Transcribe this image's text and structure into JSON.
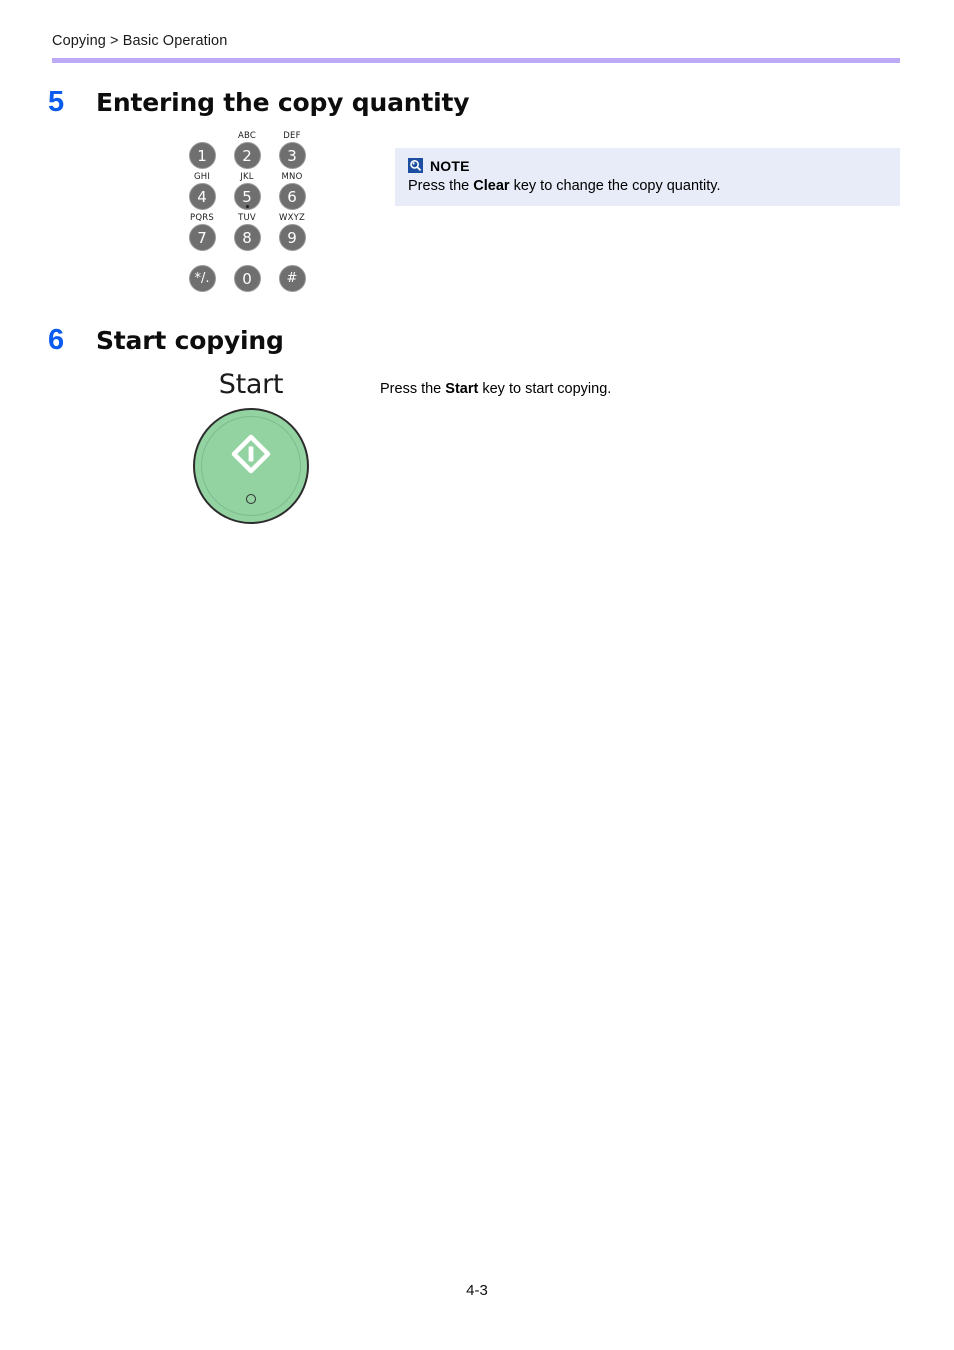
{
  "header": {
    "breadcrumb": "Copying > Basic Operation",
    "rule_color": "#bdaaf7"
  },
  "steps": [
    {
      "number": "5",
      "title": "Entering the copy quantity"
    },
    {
      "number": "6",
      "title": "Start copying"
    }
  ],
  "keypad": {
    "name": "numeric-keypad",
    "key_color": "#6f6f6f",
    "rows": [
      [
        {
          "letters": "",
          "digit": "1",
          "has_bump": false
        },
        {
          "letters": "ABC",
          "digit": "2",
          "has_bump": false
        },
        {
          "letters": "DEF",
          "digit": "3",
          "has_bump": false
        }
      ],
      [
        {
          "letters": "GHI",
          "digit": "4",
          "has_bump": false
        },
        {
          "letters": "JKL",
          "digit": "5",
          "has_bump": true
        },
        {
          "letters": "MNO",
          "digit": "6",
          "has_bump": false
        }
      ],
      [
        {
          "letters": "PQRS",
          "digit": "7",
          "has_bump": false
        },
        {
          "letters": "TUV",
          "digit": "8",
          "has_bump": false
        },
        {
          "letters": "WXYZ",
          "digit": "9",
          "has_bump": false
        }
      ],
      [
        {
          "letters": "",
          "digit": "*/.",
          "has_bump": false
        },
        {
          "letters": "",
          "digit": "0",
          "has_bump": false
        },
        {
          "letters": "",
          "digit": "#",
          "has_bump": false
        }
      ]
    ]
  },
  "note": {
    "icon": "magnifier-icon",
    "label": "NOTE",
    "text_before": "Press the ",
    "text_bold": "Clear",
    "text_after": " key to change the copy quantity.",
    "background": "#e7ecf8"
  },
  "start_key": {
    "label": "Start",
    "button_color": "#93d3a2",
    "icon": "start-diamond-icon",
    "led": "indicator-led"
  },
  "instruction": {
    "text_before": "Press the ",
    "text_bold": "Start",
    "text_after": " key to start copying."
  },
  "footer": {
    "page_number": "4-3"
  }
}
